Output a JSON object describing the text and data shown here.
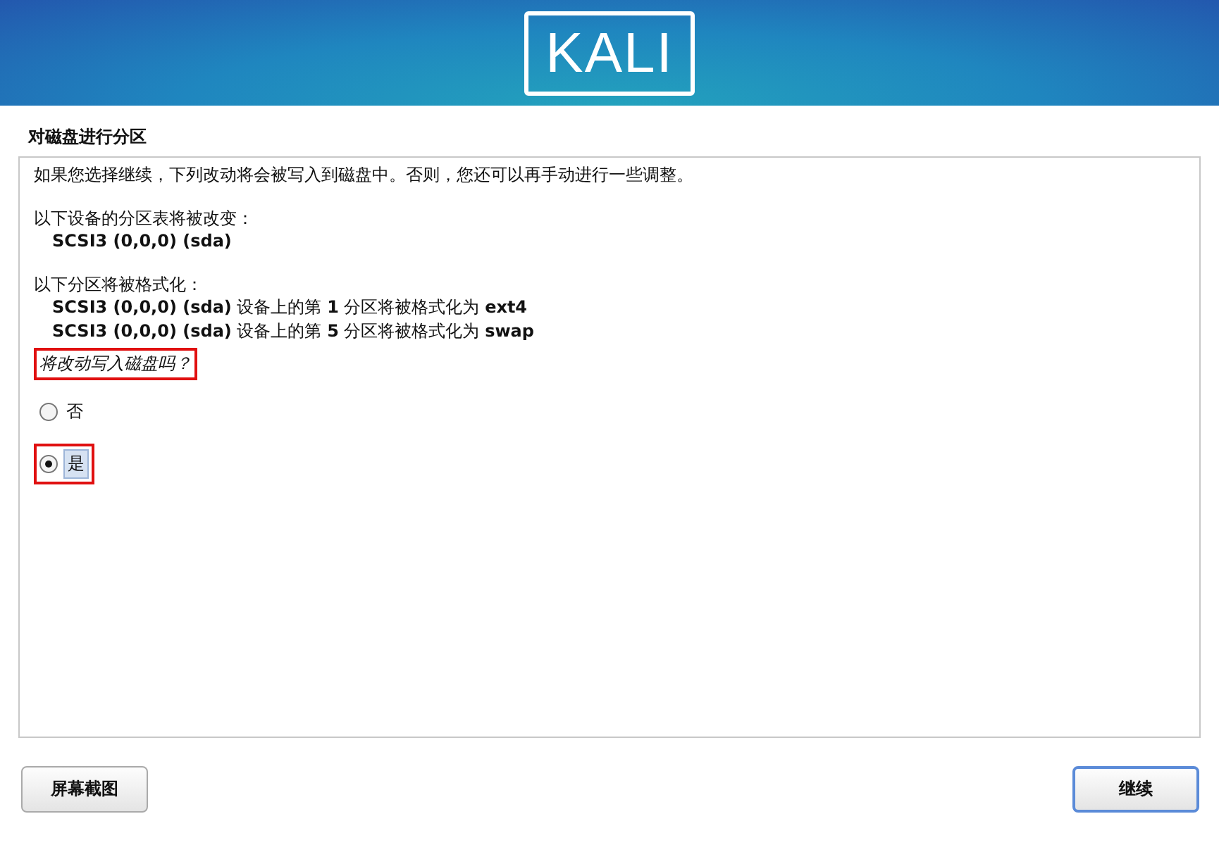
{
  "header": {
    "logo": "KALI"
  },
  "title": "对磁盘进行分区",
  "intro": "如果您选择继续，下列改动将会被写入到磁盘中。否则，您还可以再手动进行一些调整。",
  "sections": [
    {
      "heading": "以下设备的分区表将被改变：",
      "items": [
        "SCSI3 (0,0,0) (sda)"
      ]
    },
    {
      "heading": "以下分区将被格式化：",
      "items": [
        "**SCSI3 (0,0,0) (sda)** 设备上的第 **1** 分区将被格式化为 **ext4**",
        "**SCSI3 (0,0,0) (sda)** 设备上的第 **5** 分区将被格式化为 **swap**"
      ]
    }
  ],
  "question": {
    "text": "将改动写入磁盘吗？",
    "highlighted": true
  },
  "options": [
    {
      "label": "否",
      "selected": false,
      "highlighted": false
    },
    {
      "label": "是",
      "selected": true,
      "highlighted": true
    }
  ],
  "buttons": [
    {
      "label": "屏幕截图",
      "focused": false
    },
    {
      "label": "继续",
      "focused": true
    }
  ]
}
